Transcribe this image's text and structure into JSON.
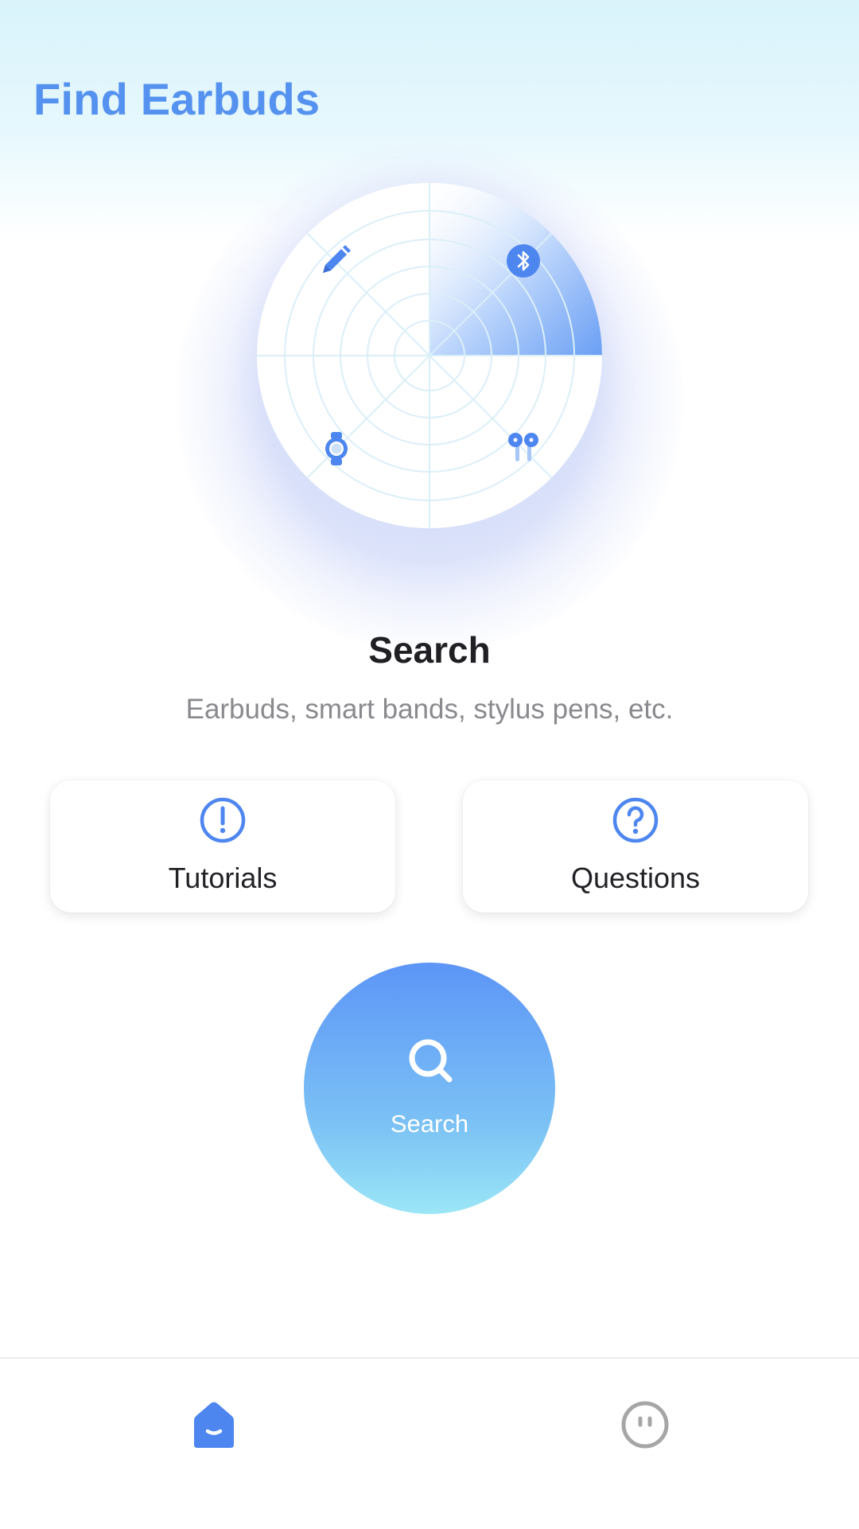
{
  "header": {
    "title": "Find Earbuds"
  },
  "radar": {
    "device_icons": [
      "stylus-pen-icon",
      "bluetooth-icon",
      "smartwatch-icon",
      "earbuds-icon"
    ]
  },
  "main": {
    "title": "Search",
    "subtitle": "Earbuds, smart bands, stylus pens, etc."
  },
  "cards": {
    "tutorials": {
      "label": "Tutorials",
      "icon": "exclamation-circle-icon"
    },
    "questions": {
      "label": "Questions",
      "icon": "question-circle-icon"
    }
  },
  "search_button": {
    "label": "Search",
    "icon": "search-icon"
  },
  "bottom_nav": {
    "items": [
      {
        "icon": "home-icon",
        "active": true
      },
      {
        "icon": "profile-icon",
        "active": false
      }
    ]
  },
  "colors": {
    "accent": "#5592f0",
    "inactive": "#a6a6a6"
  }
}
